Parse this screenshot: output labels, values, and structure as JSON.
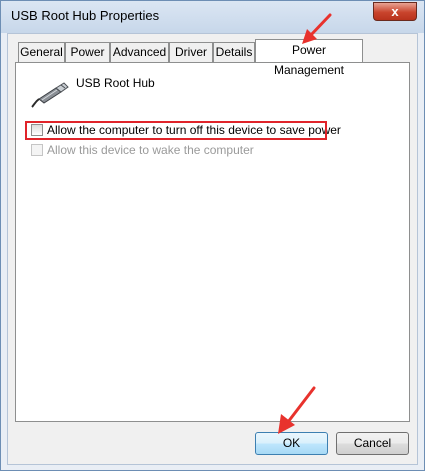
{
  "window": {
    "title": "USB Root Hub Properties",
    "close_glyph": "x"
  },
  "tabs": [
    {
      "label": "General",
      "active": false
    },
    {
      "label": "Power",
      "active": false
    },
    {
      "label": "Advanced",
      "active": false
    },
    {
      "label": "Driver",
      "active": false
    },
    {
      "label": "Details",
      "active": false
    },
    {
      "label": "Power Management",
      "active": true
    }
  ],
  "device": {
    "name": "USB Root Hub",
    "icon": "usb-connector-icon"
  },
  "options": [
    {
      "label": "Allow the computer to turn off this device to save power",
      "checked": false,
      "enabled": true
    },
    {
      "label": "Allow this device to wake the computer",
      "checked": false,
      "enabled": false
    }
  ],
  "buttons": {
    "ok": "OK",
    "cancel": "Cancel"
  },
  "annotations": {
    "highlight_color": "#e0242a",
    "arrow_color": "#e8322d"
  }
}
